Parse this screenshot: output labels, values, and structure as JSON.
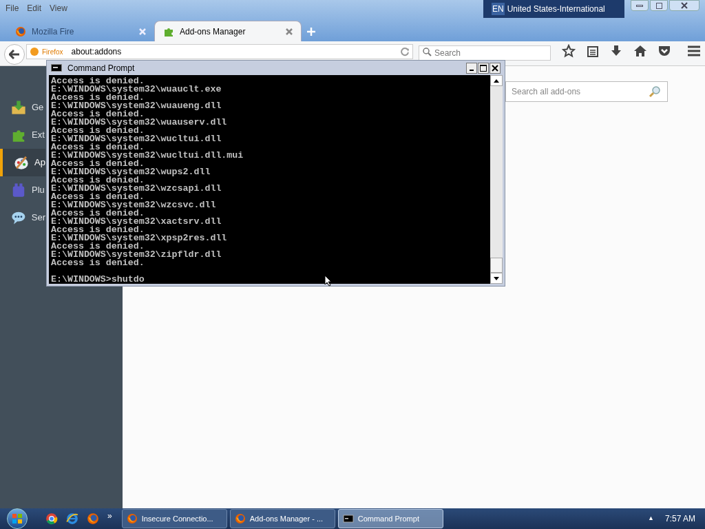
{
  "menu_bar": [
    "File",
    "Edit",
    "View"
  ],
  "language_bar": {
    "code": "EN",
    "name": "United States-International"
  },
  "tabs": [
    {
      "label": "Mozilla Fire",
      "selected": false
    },
    {
      "label": "Add-ons Manager",
      "selected": true
    }
  ],
  "address_bar": {
    "identity": "Firefox",
    "url": "about:addons"
  },
  "search": {
    "placeholder": "Search"
  },
  "addons_search": {
    "placeholder": "Search all add-ons"
  },
  "sidebar": {
    "items": [
      {
        "label": "Ge",
        "selected": false
      },
      {
        "label": "Ext",
        "selected": false
      },
      {
        "label": "Ap",
        "selected": true
      },
      {
        "label": "Plu",
        "selected": false
      },
      {
        "label": "Ser",
        "selected": false
      }
    ]
  },
  "console": {
    "title": "Command Prompt",
    "lines": [
      "Access is denied.",
      "E:\\WINDOWS\\system32\\wuauclt.exe",
      "Access is denied.",
      "E:\\WINDOWS\\system32\\wuaueng.dll",
      "Access is denied.",
      "E:\\WINDOWS\\system32\\wuauserv.dll",
      "Access is denied.",
      "E:\\WINDOWS\\system32\\wucltui.dll",
      "Access is denied.",
      "E:\\WINDOWS\\system32\\wucltui.dll.mui",
      "Access is denied.",
      "E:\\WINDOWS\\system32\\wups2.dll",
      "Access is denied.",
      "E:\\WINDOWS\\system32\\wzcsapi.dll",
      "Access is denied.",
      "E:\\WINDOWS\\system32\\wzcsvc.dll",
      "Access is denied.",
      "E:\\WINDOWS\\system32\\xactsrv.dll",
      "Access is denied.",
      "E:\\WINDOWS\\system32\\xpsp2res.dll",
      "Access is denied.",
      "E:\\WINDOWS\\system32\\zipfldr.dll",
      "Access is denied."
    ],
    "prompt": "E:\\WINDOWS>shutdo"
  },
  "taskbar": {
    "overflow": "»",
    "tasks": [
      {
        "label": "Insecure Connectio...",
        "selected": false
      },
      {
        "label": "Add-ons Manager - ...",
        "selected": false
      },
      {
        "label": "Command Prompt",
        "selected": true
      }
    ],
    "tray_arrow": "▲",
    "clock": "7:57 AM"
  }
}
